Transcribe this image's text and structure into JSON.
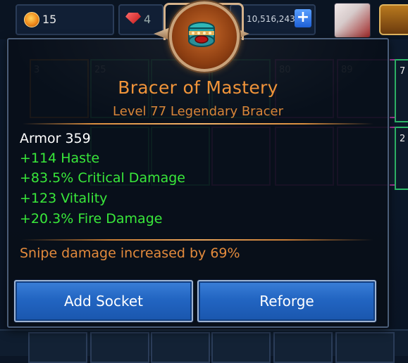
{
  "hud": {
    "gold_value": "15",
    "gems_value": "4",
    "coins_value": "10,516,243",
    "add_coins_label": "+"
  },
  "inventory_background": {
    "slot_counts_row1": [
      "3",
      "25",
      "80",
      "89"
    ],
    "slot_counts_row2": [
      "49",
      "32",
      "38",
      "24",
      "36"
    ],
    "side_labels": [
      "7",
      "2"
    ]
  },
  "tooltip": {
    "item_name": "Bracer of Mastery",
    "item_subtitle": "Level 77 Legendary Bracer",
    "armor": "Armor 359",
    "stats": [
      "+114 Haste",
      "+83.5% Critical Damage",
      "+123 Vitality",
      "+20.3% Fire Damage"
    ],
    "special_effect": "Snipe damage increased by 69%",
    "buttons": {
      "add_socket": "Add Socket",
      "reforge": "Reforge"
    }
  },
  "colors": {
    "legendary_orange": "#f0943a",
    "stat_green": "#39e83a",
    "button_blue": "#2265c2",
    "panel_bg": "#080e18"
  },
  "icons": {
    "item": "bracer-icon",
    "currency_gold": "gold-coin-icon",
    "currency_gems": "red-gem-icon"
  }
}
